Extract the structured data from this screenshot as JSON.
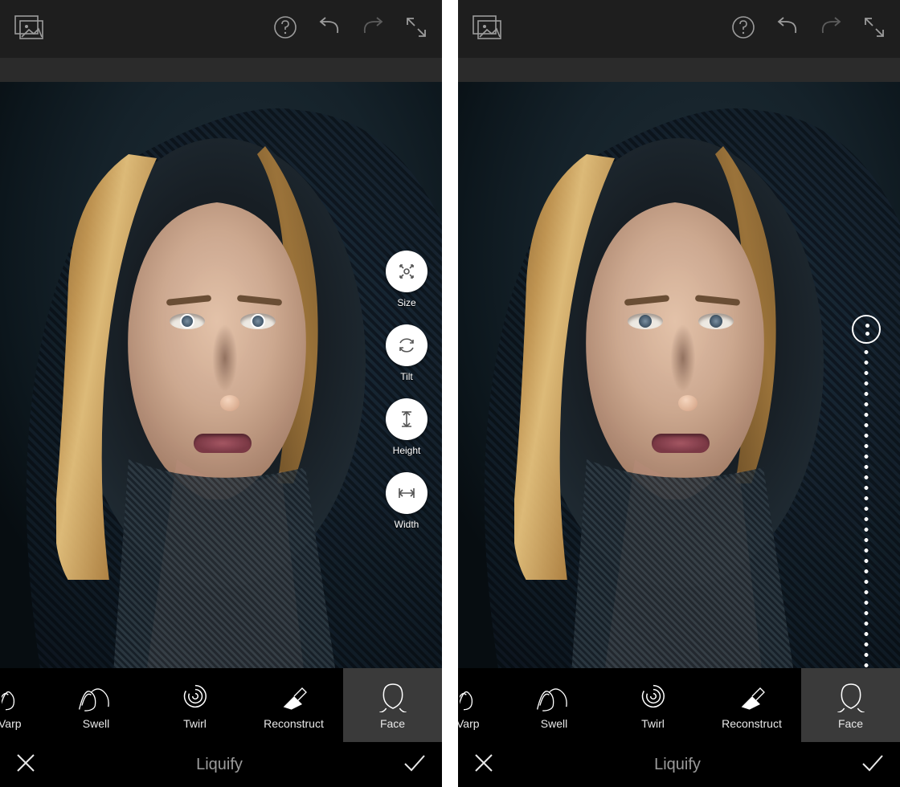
{
  "colors": {
    "topbar": "#1e1e1e",
    "subbar": "#2b2b2b",
    "panel": "#000000",
    "selected": "#3a3a3a",
    "text": "#e8e8e8",
    "muted": "#9b9b9b",
    "accentWhite": "#ffffff"
  },
  "top_icons": {
    "gallery": "gallery-icon",
    "help": "help-icon",
    "undo": "undo-icon",
    "redo": "redo-icon",
    "fullscreen": "fullscreen-icon"
  },
  "face_controls": [
    {
      "id": "size",
      "label": "Size",
      "icon": "arrows-out-icon"
    },
    {
      "id": "tilt",
      "label": "Tilt",
      "icon": "rotate-icon"
    },
    {
      "id": "height",
      "label": "Height",
      "icon": "arrows-vertical-icon"
    },
    {
      "id": "width",
      "label": "Width",
      "icon": "arrows-horizontal-icon"
    }
  ],
  "tools": [
    {
      "id": "warp",
      "label": "Warp",
      "icon": "warp-icon",
      "selected": false,
      "clipped_label": "Varp"
    },
    {
      "id": "swell",
      "label": "Swell",
      "icon": "swell-icon",
      "selected": false
    },
    {
      "id": "twirl",
      "label": "Twirl",
      "icon": "twirl-icon",
      "selected": false
    },
    {
      "id": "reconstruct",
      "label": "Reconstruct",
      "icon": "reconstruct-icon",
      "selected": false
    },
    {
      "id": "face",
      "label": "Face",
      "icon": "face-icon",
      "selected": true
    }
  ],
  "footer": {
    "title": "Liquify",
    "cancel_icon": "close-icon",
    "accept_icon": "check-icon"
  },
  "panels": {
    "left": {
      "shows_face_controls": true,
      "shows_slider": false,
      "shows_pupil_markers": true
    },
    "right": {
      "shows_face_controls": false,
      "shows_slider": true,
      "shows_pupil_markers": false
    }
  }
}
